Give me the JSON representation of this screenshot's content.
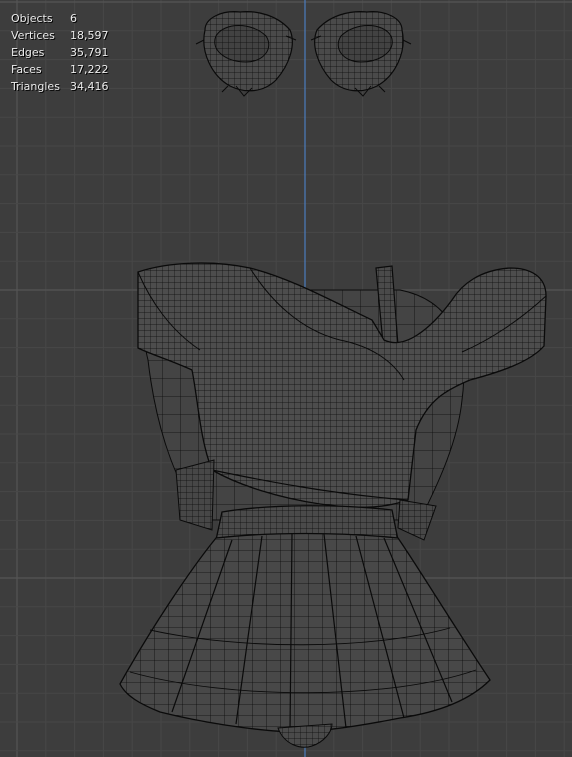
{
  "statistics": [
    {
      "label": "Objects",
      "value": "6"
    },
    {
      "label": "Vertices",
      "value": "18,597"
    },
    {
      "label": "Edges",
      "value": "35,791"
    },
    {
      "label": "Faces",
      "value": "17,222"
    },
    {
      "label": "Triangles",
      "value": "34,416"
    }
  ],
  "colors": {
    "background": "#3d3d3d",
    "grid_minor": "#474747",
    "grid_major": "#555555",
    "axis_line": "#4a78b5",
    "wire": "#0a0a0a",
    "mesh_fill": "#4a4a4a",
    "text": "#ececec"
  }
}
